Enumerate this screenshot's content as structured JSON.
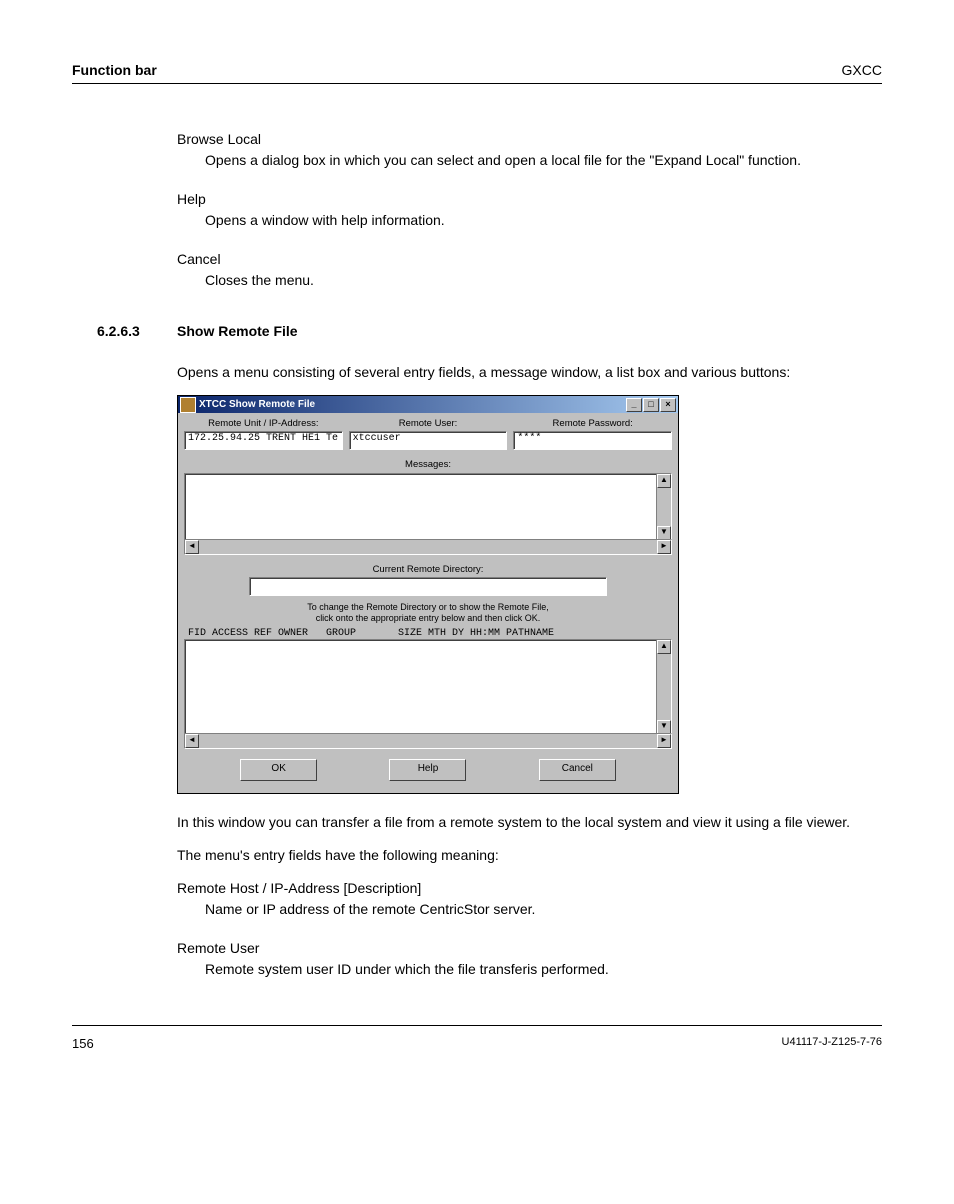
{
  "header": {
    "left": "Function bar",
    "right": "GXCC"
  },
  "defs": {
    "browse_local": {
      "term": "Browse Local",
      "desc": "Opens a dialog box in which you can select and open a local file for the \"Expand Local\" function."
    },
    "help": {
      "term": "Help",
      "desc": "Opens a window with help information."
    },
    "cancel": {
      "term": "Cancel",
      "desc": "Closes the menu."
    }
  },
  "section": {
    "num": "6.2.6.3",
    "title": "Show Remote File"
  },
  "intro_para": "Opens a menu consisting of several entry fields, a message window, a list box and various buttons:",
  "window": {
    "title": "XTCC Show Remote File",
    "labels": {
      "remote_unit": "Remote Unit / IP-Address:",
      "remote_user": "Remote User:",
      "remote_password": "Remote Password:",
      "messages": "Messages:",
      "current_remote_dir": "Current Remote Directory:"
    },
    "values": {
      "remote_unit": "172.25.94.25 TRENT HE1 Te",
      "remote_user": "xtccuser",
      "remote_password": "****",
      "remote_dir": ""
    },
    "hint_line1": "To change the Remote Directory or to show the Remote File,",
    "hint_line2": "click onto the appropriate entry below and then click OK.",
    "columns_header": "FID ACCESS REF OWNER   GROUP       SIZE MTH DY HH:MM PATHNAME",
    "buttons": {
      "ok": "OK",
      "help": "Help",
      "cancel": "Cancel"
    }
  },
  "after_para1": "In this window you can transfer a file from a remote system to the local system and view it using a file viewer.",
  "after_para2": "The menu's entry fields have the following meaning:",
  "defs2": {
    "remote_host": {
      "term": "Remote Host / IP-Address [Description]",
      "desc": "Name or IP address of the remote CentricStor server."
    },
    "remote_user": {
      "term": "Remote User",
      "desc": "Remote system user ID under which the file transferis performed."
    }
  },
  "footer": {
    "page": "156",
    "docid": "U41117-J-Z125-7-76"
  }
}
